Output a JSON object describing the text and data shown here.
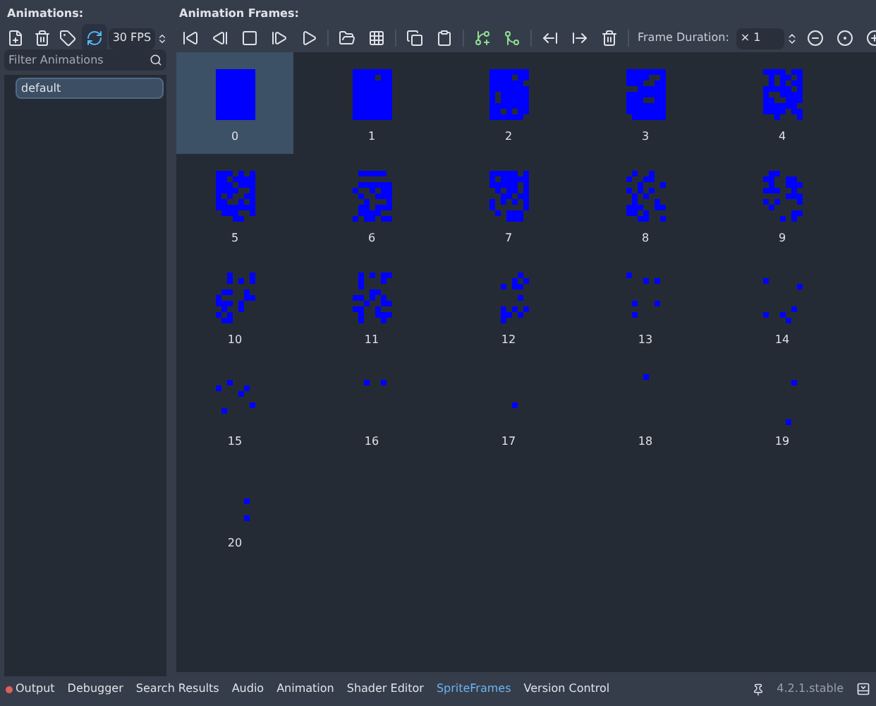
{
  "animations_panel": {
    "title": "Animations:",
    "filter": {
      "placeholder": "Filter Animations"
    },
    "items": [
      {
        "label": "default",
        "selected": true
      }
    ]
  },
  "toolbar": {
    "loop": {
      "on": true
    },
    "fps": "30 FPS",
    "frame_duration_label": "Frame Duration:",
    "frame_duration": "× 1"
  },
  "frames_panel": {
    "title": "Animation Frames:",
    "frames": [
      {
        "label": "0",
        "selected": true
      },
      {
        "label": "1",
        "selected": false
      },
      {
        "label": "2",
        "selected": false
      },
      {
        "label": "3",
        "selected": false
      },
      {
        "label": "4",
        "selected": false
      },
      {
        "label": "5",
        "selected": false
      },
      {
        "label": "6",
        "selected": false
      },
      {
        "label": "7",
        "selected": false
      },
      {
        "label": "8",
        "selected": false
      },
      {
        "label": "9",
        "selected": false
      },
      {
        "label": "10",
        "selected": false
      },
      {
        "label": "11",
        "selected": false
      },
      {
        "label": "12",
        "selected": false
      },
      {
        "label": "13",
        "selected": false
      },
      {
        "label": "14",
        "selected": false
      },
      {
        "label": "15",
        "selected": false
      },
      {
        "label": "16",
        "selected": false
      },
      {
        "label": "17",
        "selected": false
      },
      {
        "label": "18",
        "selected": false
      },
      {
        "label": "19",
        "selected": false
      },
      {
        "label": "20",
        "selected": false
      }
    ]
  },
  "bottom_tabs": [
    {
      "label": "Output",
      "selected": false,
      "color": "#e0605c"
    },
    {
      "label": "Debugger",
      "selected": false
    },
    {
      "label": "Search Results",
      "selected": false
    },
    {
      "label": "Audio",
      "selected": false
    },
    {
      "label": "Animation",
      "selected": false
    },
    {
      "label": "Shader Editor",
      "selected": false
    },
    {
      "label": "SpriteFrames",
      "selected": true
    },
    {
      "label": "Version Control",
      "selected": false
    }
  ],
  "version": "4.2.1.stable"
}
